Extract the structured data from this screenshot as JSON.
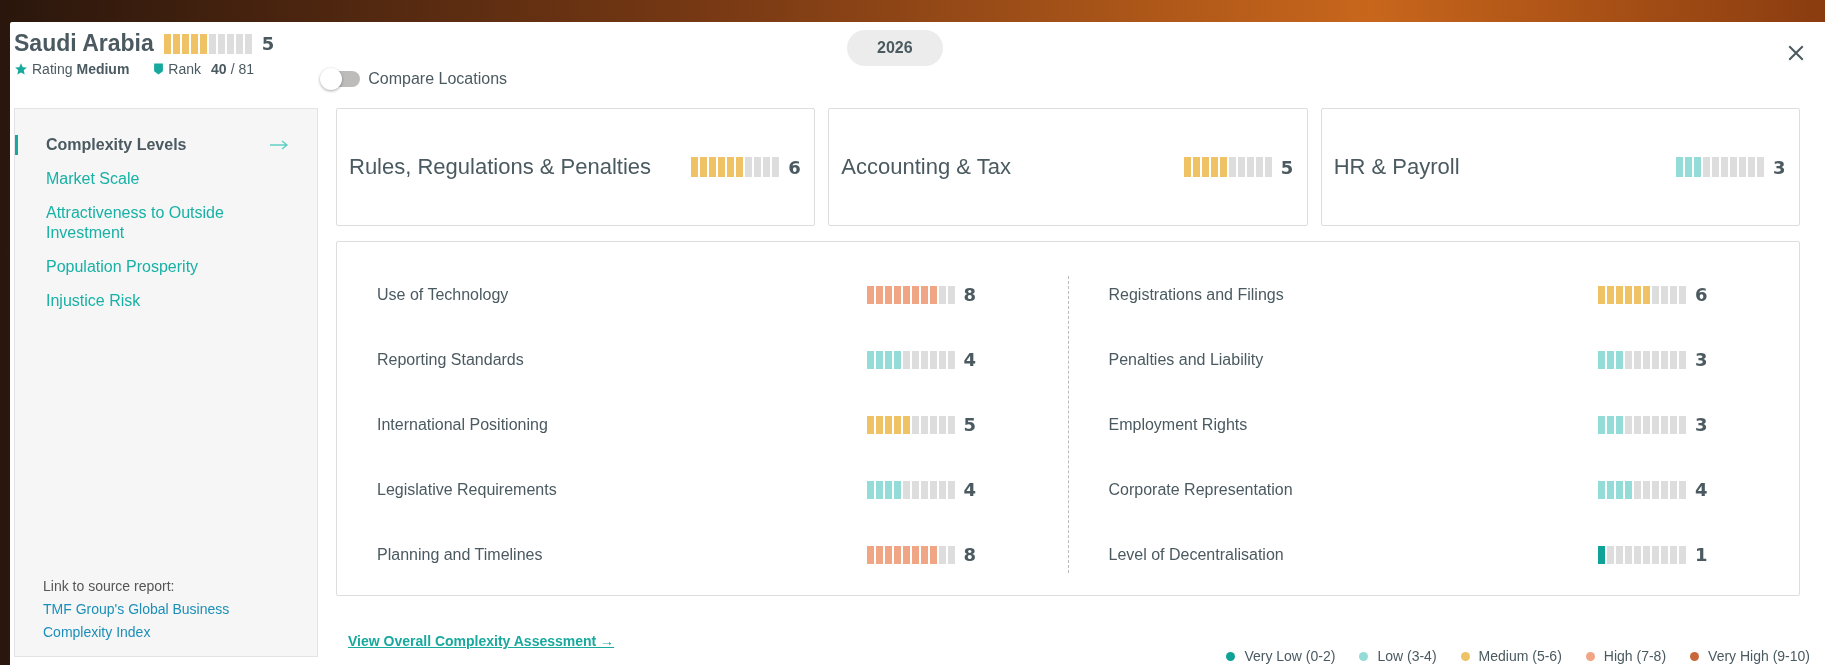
{
  "header": {
    "country": "Saudi Arabia",
    "level": 0.5,
    "score": "5",
    "rating_label": "Rating",
    "rating": "Medium",
    "rank_label": "Rank",
    "rank": "40",
    "rank_total": "/ 81",
    "compare": {
      "label": "Compare Locations",
      "on": false
    }
  },
  "year": "2026",
  "sidebar": {
    "items": [
      {
        "label": "Complexity Levels",
        "selected": true
      },
      {
        "label": "Market Scale",
        "selected": false
      },
      {
        "label": "Attractiveness to Outside Investment",
        "selected": false
      },
      {
        "label": "Population Prosperity",
        "selected": false
      },
      {
        "label": "Injustice Risk",
        "selected": false
      }
    ],
    "source_text": "Link to source report:",
    "source_link": "TMF Group's Global Business Complexity Index"
  },
  "categories": [
    {
      "label": "Rules, Regulations & Penalties",
      "level": 0.6,
      "score": "6"
    },
    {
      "label": "Accounting & Tax",
      "level": 0.5,
      "score": "5"
    },
    {
      "label": "HR & Payroll",
      "level": 0.3,
      "score": "3"
    }
  ],
  "indicators": [
    [
      {
        "label": "Use of Technology",
        "level": 0.8,
        "score": "8"
      },
      {
        "label": "Reporting Standards",
        "level": 0.4,
        "score": "4"
      },
      {
        "label": "International Positioning",
        "level": 0.5,
        "score": "5"
      },
      {
        "label": "Legislative Requirements",
        "level": 0.4,
        "score": "4"
      },
      {
        "label": "Planning and Timelines",
        "level": 0.8,
        "score": "8"
      }
    ],
    [
      {
        "label": "Registrations and Filings",
        "level": 0.6,
        "score": "6"
      },
      {
        "label": "Penalties and Liability",
        "level": 0.3,
        "score": "3"
      },
      {
        "label": "Employment Rights",
        "level": 0.3,
        "score": "3"
      },
      {
        "label": "Corporate Representation",
        "level": 0.4,
        "score": "4"
      },
      {
        "label": "Level of Decentralisation",
        "level": 0.1,
        "score": "1"
      }
    ]
  ],
  "overall_link": "View Overall Complexity Assessment →",
  "legend": [
    {
      "label": "Very Low (0-2)",
      "color": "#0fa397"
    },
    {
      "label": "Low (3-4)",
      "color": "#93dcd8"
    },
    {
      "label": "Medium (5-6)",
      "color": "#efc266"
    },
    {
      "label": "High (7-8)",
      "color": "#f0a584"
    },
    {
      "label": "Very High (9-10)",
      "color": "#c8683a"
    }
  ]
}
